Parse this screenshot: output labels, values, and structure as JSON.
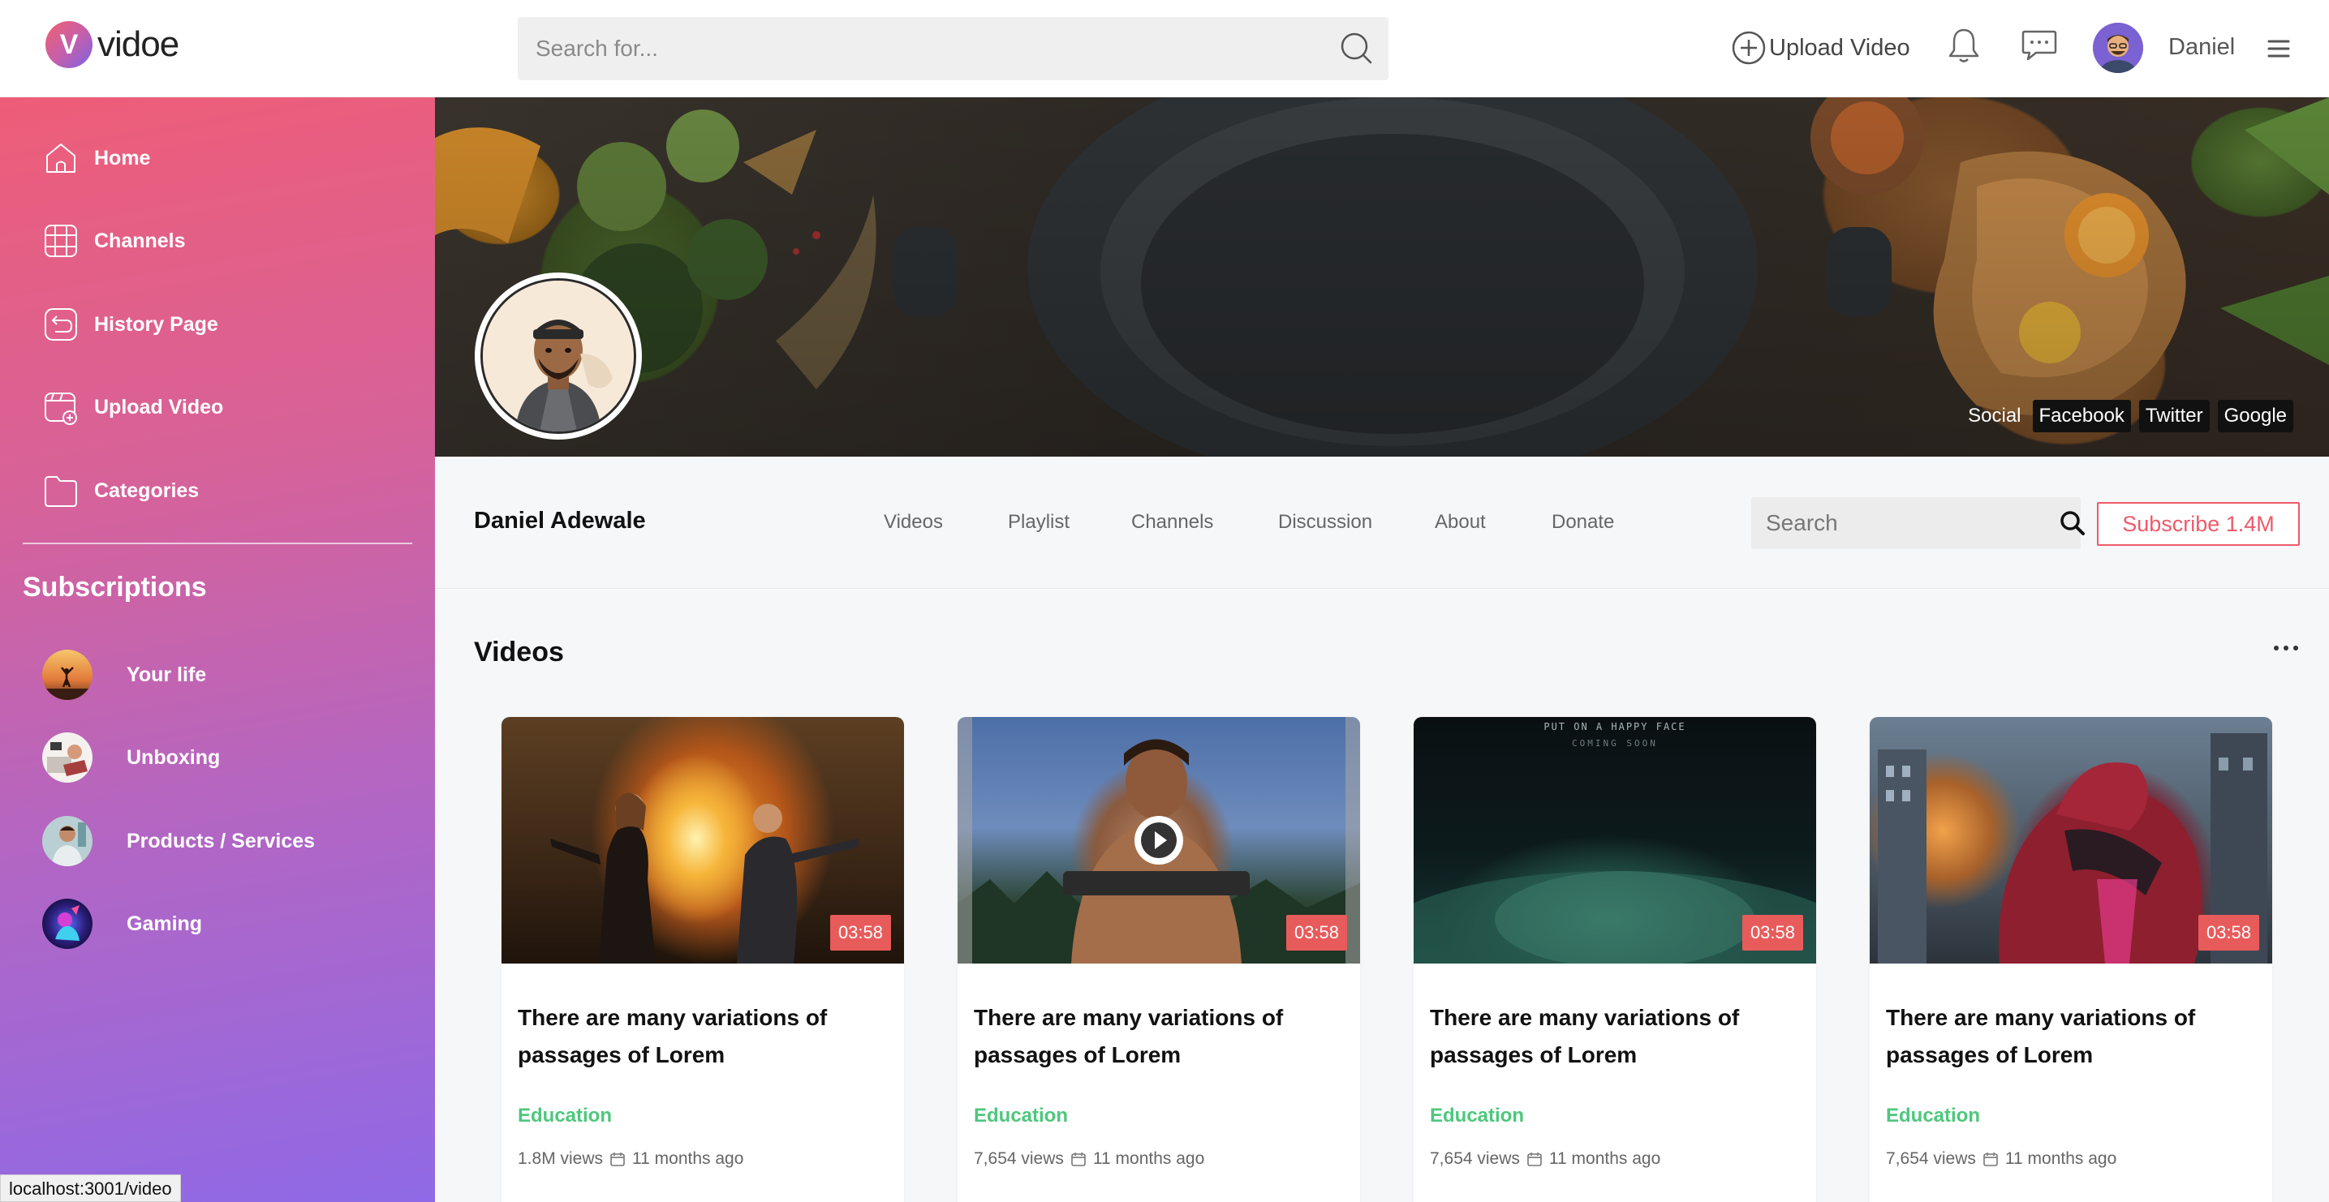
{
  "app": {
    "logo_letter": "V",
    "logo_text": "vidoe"
  },
  "topbar": {
    "search_placeholder": "Search for...",
    "upload_label": "Upload Video",
    "user_name": "Daniel"
  },
  "sidebar": {
    "items": [
      {
        "label": "Home",
        "icon": "home-icon"
      },
      {
        "label": "Channels",
        "icon": "channels-icon"
      },
      {
        "label": "History Page",
        "icon": "history-icon"
      },
      {
        "label": "Upload Video",
        "icon": "upload-video-icon"
      },
      {
        "label": "Categories",
        "icon": "folder-icon"
      }
    ],
    "subscriptions_title": "Subscriptions",
    "subscriptions": [
      {
        "label": "Your life"
      },
      {
        "label": "Unboxing"
      },
      {
        "label": "Products / Services"
      },
      {
        "label": "Gaming"
      }
    ]
  },
  "banner": {
    "social_label": "Social",
    "social_links": [
      "Facebook",
      "Twitter",
      "Google"
    ]
  },
  "channel": {
    "name": "Daniel Adewale",
    "tabs": [
      "Videos",
      "Playlist",
      "Channels",
      "Discussion",
      "About",
      "Donate"
    ],
    "search_placeholder": "Search",
    "subscribe_label": "Subscribe 1.4M"
  },
  "videos": {
    "section_title": "Videos",
    "items": [
      {
        "duration": "03:58",
        "title": "There are many variations of passages of Lorem",
        "category": "Education",
        "views": "1.8M views",
        "age": "11 months ago"
      },
      {
        "duration": "03:58",
        "title": "There are many variations of passages of Lorem",
        "category": "Education",
        "views": "7,654 views",
        "age": "11 months ago"
      },
      {
        "duration": "03:58",
        "title": "There are many variations of passages of Lorem",
        "category": "Education",
        "views": "7,654 views",
        "age": "11 months ago"
      },
      {
        "duration": "03:58",
        "title": "There are many variations of passages of Lorem",
        "category": "Education",
        "views": "7,654 views",
        "age": "11 months ago"
      }
    ],
    "thumb3_caption_1": "PUT ON A HAPPY FACE",
    "thumb3_caption_2": "COMING SOON"
  },
  "statusbar": {
    "url": "localhost:3001/video"
  },
  "colors": {
    "accent_red": "#ee5a6a",
    "category_green": "#4ec77d",
    "sidebar_gradient_top": "#ee5d78",
    "sidebar_gradient_bottom": "#8f69e6"
  }
}
